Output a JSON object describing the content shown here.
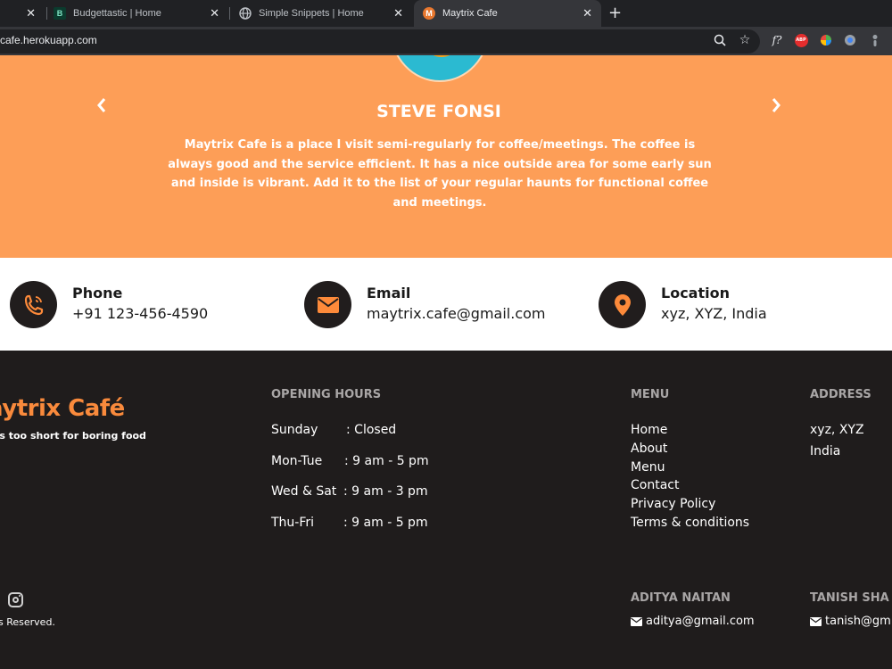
{
  "browser": {
    "tabs": [
      {
        "title": "",
        "active": false
      },
      {
        "title": "Budgettastic | Home",
        "active": false
      },
      {
        "title": "Simple Snippets | Home",
        "active": false
      },
      {
        "title": "Maytrix Cafe",
        "active": true
      }
    ],
    "url": "cafe.herokuapp.com",
    "extension_labels": {
      "formula": "f?",
      "abp": "ABP"
    }
  },
  "testimonial": {
    "name": "STEVE FONSI",
    "quote": "Maytrix Cafe is a place I visit semi-regularly for coffee/meetings. The coffee is always good and the service efficient. It has a nice outside area for some early sun and inside is vibrant. Add it to the list of your regular haunts for functional coffee and meetings."
  },
  "contact": {
    "phone": {
      "title": "Phone",
      "value": "+91 123-456-4590"
    },
    "email": {
      "title": "Email",
      "value": "maytrix.cafe@gmail.com"
    },
    "location": {
      "title": "Location",
      "value": "xyz, XYZ, India"
    }
  },
  "footer": {
    "logo": "aytrix Café",
    "tagline": "'s too short for boring food",
    "opening_hours": {
      "heading": "OPENING HOURS",
      "rows": [
        {
          "day": "Sunday",
          "time": ":  Closed"
        },
        {
          "day": "Mon-Tue",
          "time": ":  9 am - 5 pm"
        },
        {
          "day": "Wed & Sat",
          "time": ":  9 am - 3 pm"
        },
        {
          "day": "Thu-Fri",
          "time": ":  9 am - 5 pm"
        }
      ]
    },
    "menu": {
      "heading": "MENU",
      "links": [
        "Home",
        "About",
        "Menu",
        "Contact",
        "Privacy Policy",
        "Terms & conditions"
      ]
    },
    "address": {
      "heading": "ADDRESS",
      "line1": "xyz, XYZ",
      "line2": "India"
    },
    "rights": "s Reserved.",
    "devs": [
      {
        "name": "ADITYA NAITAN",
        "email": "aditya@gmail.com"
      },
      {
        "name": "TANISH SHA",
        "email": "tanish@gm"
      }
    ]
  },
  "colors": {
    "accent": "#fd9e57",
    "footer_bg": "#1f1c1c",
    "logo_orange": "#f98a3c",
    "icon_orange": "#fd8a3a"
  }
}
